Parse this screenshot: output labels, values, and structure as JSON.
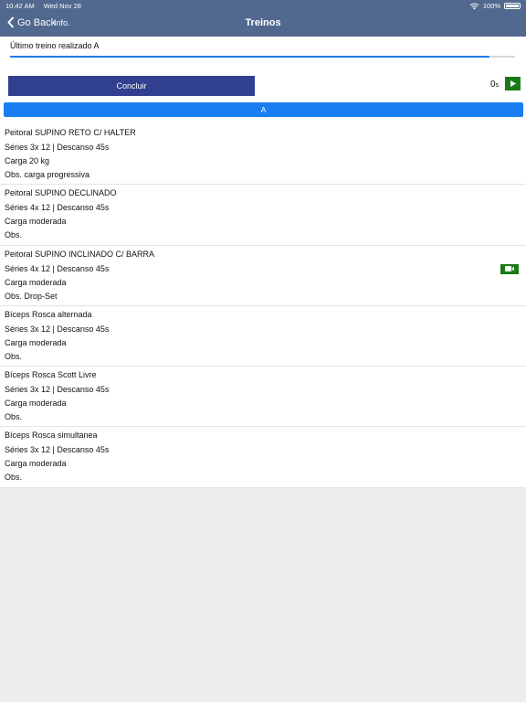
{
  "status_bar": {
    "time": "10:42 AM",
    "date": "Wed Nov 28",
    "battery": "100%"
  },
  "nav": {
    "back_label": "Go Back",
    "info_label": "Info.",
    "title": "Treinos"
  },
  "last_workout": {
    "label": "Último treino realizado A",
    "progress": 0.95
  },
  "actions": {
    "conclude_label": "Concluir",
    "timer_value": "0",
    "timer_unit": "s"
  },
  "tab": {
    "label": "A"
  },
  "exercises": [
    {
      "name": "Peitoral SUPINO RETO C/ HALTER",
      "series": "Séries 3x 12 | Descanso 45s",
      "load": "Carga 20 kg",
      "obs": "Obs. carga progressiva",
      "video": false
    },
    {
      "name": "Peitoral SUPINO DECLINADO",
      "series": "Séries 4x 12 | Descanso 45s",
      "load": "Carga moderada",
      "obs": "Obs.",
      "video": false
    },
    {
      "name": "Peitoral SUPINO INCLINADO C/ BARRA",
      "series": "Séries 4x 12 | Descanso 45s",
      "load": "Carga moderada",
      "obs": "Obs. Drop-Set",
      "video": true
    },
    {
      "name": "Bíceps Rosca alternada",
      "series": "Séries 3x 12 | Descanso 45s",
      "load": "Carga moderada",
      "obs": "Obs.",
      "video": false
    },
    {
      "name": "Bíceps Rosca Scott Livre",
      "series": "Séries 3x 12 | Descanso 45s",
      "load": "Carga moderada",
      "obs": "Obs.",
      "video": false
    },
    {
      "name": "Bíceps Rosca simultanea",
      "series": "Séries 3x 12 | Descanso 45s",
      "load": "Carga moderada",
      "obs": "Obs.",
      "video": false
    }
  ]
}
